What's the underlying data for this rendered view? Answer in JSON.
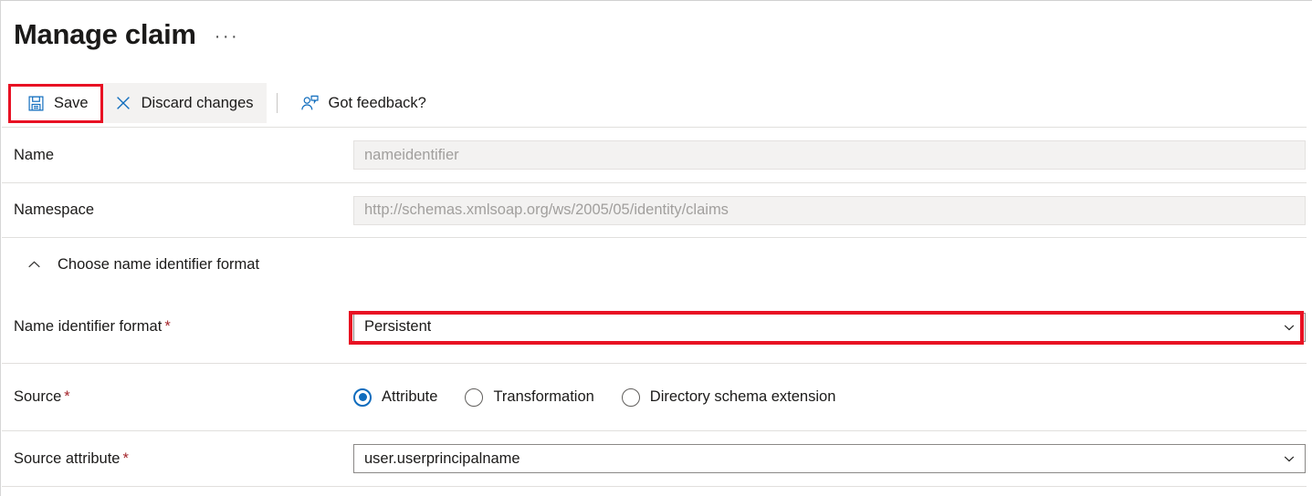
{
  "header": {
    "title": "Manage claim",
    "ellipsis": "···",
    "ellipsis_name": "more-options"
  },
  "toolbar": {
    "save_label": "Save",
    "discard_label": "Discard changes",
    "feedback_label": "Got feedback?",
    "icons": {
      "save": "save-floppy-icon",
      "discard": "close-x-icon",
      "feedback": "person-feedback-icon"
    }
  },
  "form": {
    "name": {
      "label": "Name",
      "value": "",
      "placeholder": "nameidentifier",
      "disabled": true
    },
    "namespace": {
      "label": "Namespace",
      "value": "",
      "placeholder": "http://schemas.xmlsoap.org/ws/2005/05/identity/claims",
      "disabled": true
    },
    "section": {
      "title": "Choose name identifier format",
      "expanded": true,
      "chevron": "chevron-up-icon"
    },
    "name_identifier_format": {
      "label": "Name identifier format",
      "required_marker": "*",
      "value": "Persistent",
      "chevron": "chevron-down-icon"
    },
    "source": {
      "label": "Source",
      "required_marker": "*",
      "options": [
        {
          "label": "Attribute",
          "selected": true
        },
        {
          "label": "Transformation",
          "selected": false
        },
        {
          "label": "Directory schema extension",
          "selected": false
        }
      ]
    },
    "source_attribute": {
      "label": "Source attribute",
      "required_marker": "*",
      "value": "user.userprincipalname",
      "chevron": "chevron-down-icon"
    }
  },
  "highlights": {
    "save_box_color": "#e81123",
    "name_identifier_box_color": "#e81123"
  },
  "colors": {
    "accent": "#0f6cbd",
    "required": "#a4262c",
    "highlight": "#e81123",
    "disabled_bg": "#f3f2f1",
    "divider": "#e1dfdd"
  }
}
